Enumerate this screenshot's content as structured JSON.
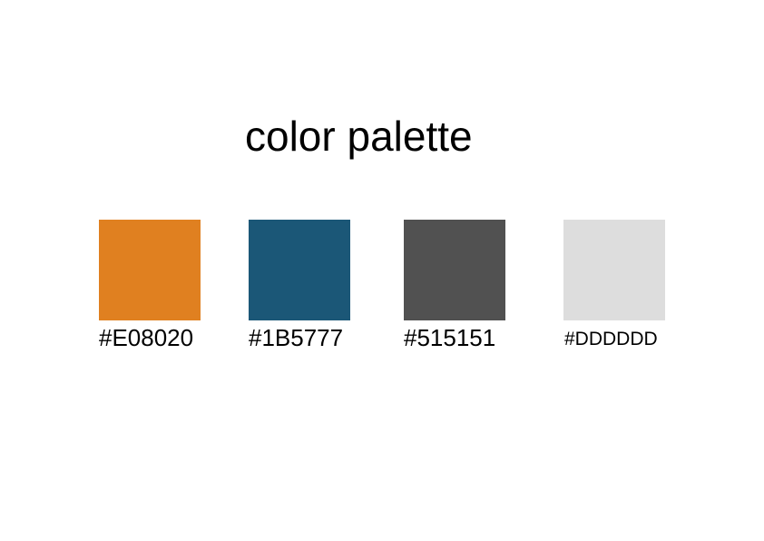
{
  "title": "color palette",
  "swatches": [
    {
      "color": "#E08020",
      "label": "#E08020"
    },
    {
      "color": "#1B5777",
      "label": "#1B5777"
    },
    {
      "color": "#515151",
      "label": "#515151"
    },
    {
      "color": "#DDDDDD",
      "label": "#DDDDDD"
    }
  ]
}
